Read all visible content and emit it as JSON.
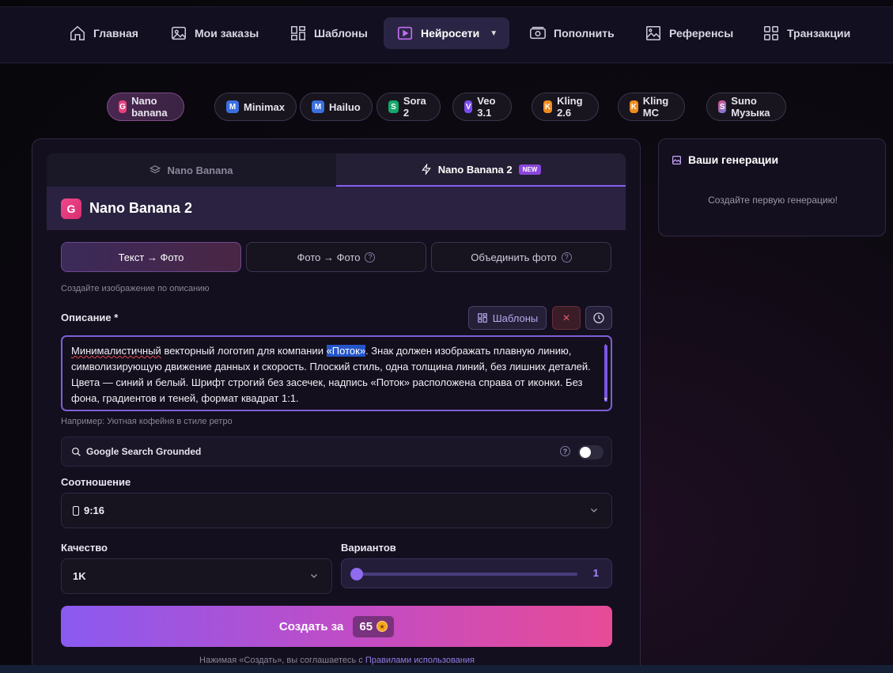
{
  "nav": {
    "items": [
      {
        "label": "Главная",
        "icon": "home-icon"
      },
      {
        "label": "Мои заказы",
        "icon": "image-icon"
      },
      {
        "label": "Шаблоны",
        "icon": "grid-icon"
      },
      {
        "label": "Нейросети",
        "icon": "play-icon"
      },
      {
        "label": "Пополнить",
        "icon": "wallet-icon"
      },
      {
        "label": "Референсы",
        "icon": "picture-icon"
      },
      {
        "label": "Транзакции",
        "icon": "apps-icon"
      }
    ]
  },
  "models": [
    {
      "badge": "G",
      "label": "Nano banana",
      "color": "#e8417f"
    },
    {
      "badge": "M",
      "label": "Minimax",
      "color": "#3b6fe0"
    },
    {
      "badge": "M",
      "label": "Hailuo",
      "color": "#3b6fe0"
    },
    {
      "badge": "S",
      "label": "Sora 2",
      "color": "#17a86b"
    },
    {
      "badge": "V",
      "label": "Veo 3.1",
      "color": "#7c4df0"
    },
    {
      "badge": "K",
      "label": "Kling 2.6",
      "color": "#f08b1e"
    },
    {
      "badge": "K",
      "label": "Kling MC",
      "color": "#f08b1e"
    },
    {
      "badge": "S",
      "label": "Suno Музыка",
      "color": "#c0509a"
    }
  ],
  "model_tabs": {
    "tab1": "Nano Banana",
    "tab2": "Nano Banana 2",
    "new_badge": "NEW"
  },
  "model_header": {
    "badge": "G",
    "title": "Nano Banana 2"
  },
  "modes": {
    "text_to_photo": "Текст → Фото",
    "photo_to_photo": "Фото → Фото",
    "merge_photo": "Объединить фото",
    "help": "?"
  },
  "mode_hint": "Создайте изображение по описанию",
  "description": {
    "label": "Описание *",
    "templates_button": "Шаблоны",
    "clear_button": "✕",
    "text_part1": "Минималистичный",
    "text_part2": " векторный логотип для компании ",
    "text_selected": "«Поток»",
    "text_part3": ". Знак должен изображать плавную линию, символизирующую движение данных и скорость. Плоский стиль, одна толщина линий, без лишних деталей. Цвета — синий и белый. Шрифт строгий без засечек, надпись «Поток» расположена справа от иконки. Без фона, градиентов и теней, формат квадрат 1:1.",
    "example": "Например: Уютная кофейня в стиле ретро"
  },
  "grounding": {
    "label": "Google Search Grounded",
    "help": "?",
    "enabled": false
  },
  "ratio": {
    "label": "Соотношение",
    "value": "9:16"
  },
  "quality": {
    "label": "Качество",
    "value": "1K"
  },
  "variants": {
    "label": "Вариантов",
    "value": "1"
  },
  "create": {
    "label": "Создать за",
    "price": "65"
  },
  "terms": {
    "text": "Нажимая «Создать», вы соглашаетесь с ",
    "link": "Правилами использования"
  },
  "side": {
    "title": "Ваши генерации",
    "empty": "Создайте первую генерацию!"
  }
}
